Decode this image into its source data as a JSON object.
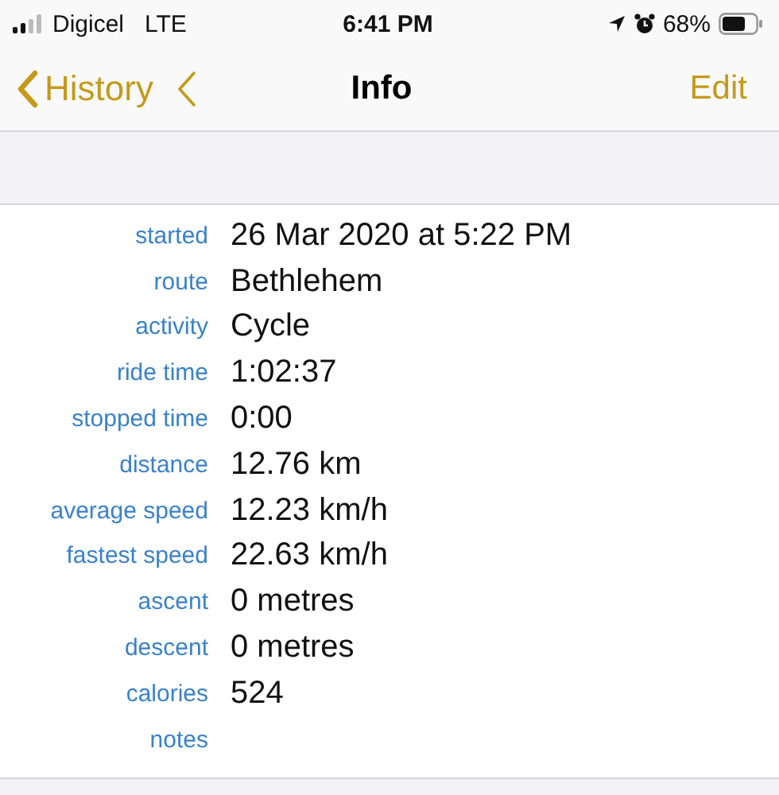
{
  "status_bar": {
    "carrier": "Digicel",
    "network": "LTE",
    "time": "6:41 PM",
    "battery": "68%"
  },
  "nav": {
    "back": "History",
    "title": "Info",
    "action": "Edit"
  },
  "fields": [
    {
      "label": "started",
      "value": "26 Mar 2020 at 5:22 PM"
    },
    {
      "label": "route",
      "value": "Bethlehem"
    },
    {
      "label": "activity",
      "value": "Cycle"
    },
    {
      "label": "ride time",
      "value": "1:02:37"
    },
    {
      "label": "stopped time",
      "value": "0:00"
    },
    {
      "label": "distance",
      "value": "12.76 km"
    },
    {
      "label": "average speed",
      "value": "12.23 km/h"
    },
    {
      "label": "fastest speed",
      "value": "22.63 km/h"
    },
    {
      "label": "ascent",
      "value": "0 metres"
    },
    {
      "label": "descent",
      "value": "0 metres"
    },
    {
      "label": "calories",
      "value": "524"
    },
    {
      "label": "notes"
    }
  ]
}
